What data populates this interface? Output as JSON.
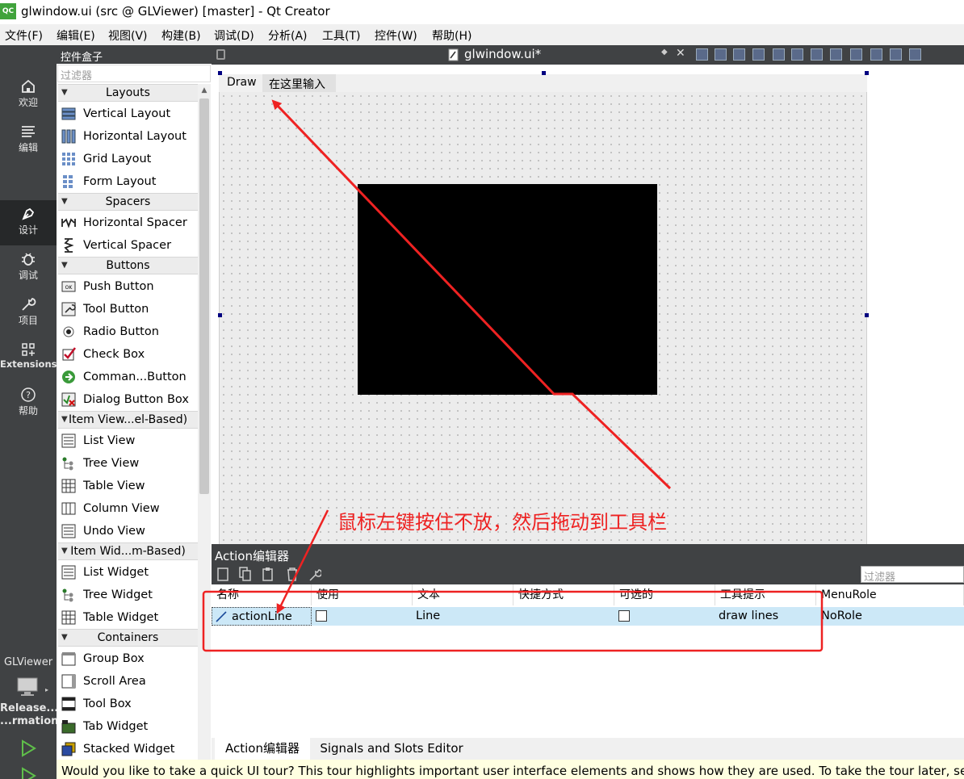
{
  "window": {
    "title": "glwindow.ui (src @ GLViewer) [master] - Qt Creator",
    "logo": "QC"
  },
  "menubar": [
    "文件(F)",
    "编辑(E)",
    "视图(V)",
    "构建(B)",
    "调试(D)",
    "分析(A)",
    "工具(T)",
    "控件(W)",
    "帮助(H)"
  ],
  "modes": [
    {
      "label": "欢迎",
      "icon": "home-icon"
    },
    {
      "label": "编辑",
      "icon": "edit-lines-icon"
    },
    {
      "label": "设计",
      "icon": "pen-icon"
    },
    {
      "label": "调试",
      "icon": "bug-icon"
    },
    {
      "label": "项目",
      "icon": "wrench-icon"
    },
    {
      "label": "Extensions",
      "icon": "extensions-icon"
    },
    {
      "label": "帮助",
      "icon": "help-icon"
    }
  ],
  "kit": {
    "project": "GLViewer",
    "config": "Release...",
    "config2": "...rmation"
  },
  "widgetbox": {
    "title": "控件盒子",
    "filter_placeholder": "过滤器",
    "categories": {
      "layouts": "Layouts",
      "spacers": "Spacers",
      "buttons": "Buttons",
      "itemviews": "Item View...el-Based)",
      "itemwidgets": "Item Wid...m-Based)",
      "containers": "Containers"
    },
    "items": {
      "vertical_layout": "Vertical Layout",
      "horizontal_layout": "Horizontal Layout",
      "grid_layout": "Grid Layout",
      "form_layout": "Form Layout",
      "horizontal_spacer": "Horizontal Spacer",
      "vertical_spacer": "Vertical Spacer",
      "push_button": "Push Button",
      "tool_button": "Tool Button",
      "radio_button": "Radio Button",
      "check_box": "Check Box",
      "command_link": "Comman...Button",
      "dialog_button_box": "Dialog Button Box",
      "list_view": "List View",
      "tree_view": "Tree View",
      "table_view": "Table View",
      "column_view": "Column View",
      "undo_view": "Undo View",
      "list_widget": "List Widget",
      "tree_widget": "Tree Widget",
      "table_widget": "Table Widget",
      "group_box": "Group Box",
      "scroll_area": "Scroll Area",
      "tool_box": "Tool Box",
      "tab_widget": "Tab Widget",
      "stacked_widget": "Stacked Widget"
    }
  },
  "editor": {
    "filename": "glwindow.ui*",
    "form_menu": {
      "draw": "Draw",
      "enter_here": "在这里输入"
    },
    "annotation": "鼠标左键按住不放，然后拖动到工具栏"
  },
  "action_editor": {
    "title": "Action编辑器",
    "filter_placeholder": "过滤器",
    "columns": [
      "名称",
      "使用",
      "文本",
      "快捷方式",
      "可选的",
      "工具提示",
      "MenuRole"
    ],
    "row": {
      "name": "actionLine",
      "used": false,
      "text": "Line",
      "shortcut": "",
      "checkable": false,
      "tooltip": "draw lines",
      "menurole": "NoRole"
    }
  },
  "bottom_tabs": [
    "Action编辑器",
    "Signals and Slots Editor"
  ],
  "tour_text": "Would you like to take a quick UI tour? This tour highlights important user interface elements and shows how they are used. To take the tour later, select Help",
  "colors": {
    "annotation": "#ee2222",
    "sidebar": "#404244",
    "selection": "#cce8f7"
  }
}
